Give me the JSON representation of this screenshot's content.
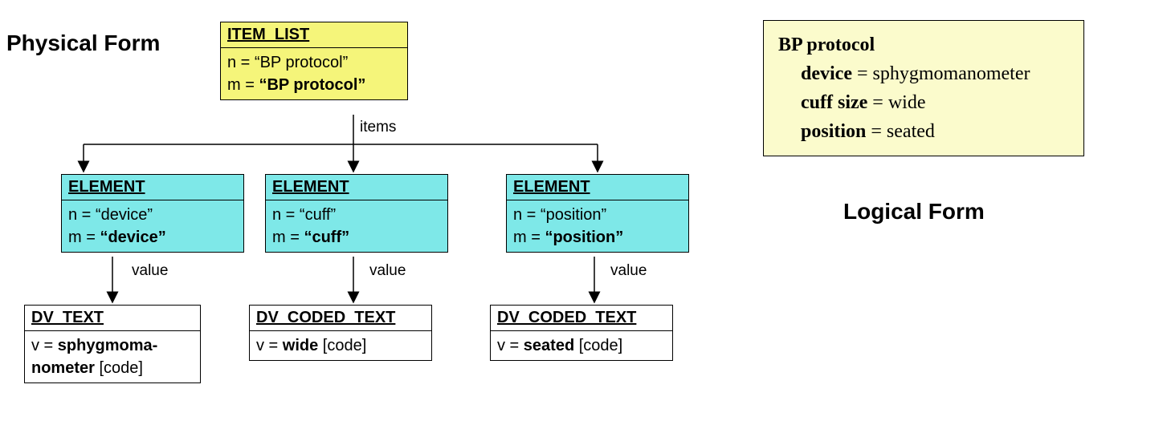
{
  "titles": {
    "physical": "Physical Form",
    "logical": "Logical Form"
  },
  "root": {
    "type": "ITEM_LIST",
    "n": "n = “BP protocol”",
    "m_prefix": "m = ",
    "m_val": "“BP protocol”",
    "edge": "items"
  },
  "elements": [
    {
      "type": "ELEMENT",
      "n": "n = “device”",
      "m_prefix": "m = ",
      "m_val": "“device”",
      "edge": "value",
      "value_type": "DV_TEXT",
      "v_prefix": "v = ",
      "v_bold": "sphygmoma-\nnometer",
      "v_suffix": " [code]"
    },
    {
      "type": "ELEMENT",
      "n": "n = “cuff”",
      "m_prefix": "m = ",
      "m_val": "“cuff”",
      "edge": "value",
      "value_type": "DV_CODED_TEXT",
      "v_prefix": "v = ",
      "v_bold": "wide",
      "v_suffix": " [code]"
    },
    {
      "type": "ELEMENT",
      "n": "n = “position”",
      "m_prefix": "m = ",
      "m_val": "“position”",
      "edge": "value",
      "value_type": "DV_CODED_TEXT",
      "v_prefix": "v = ",
      "v_bold": "seated",
      "v_suffix": " [code]"
    }
  ],
  "logical": {
    "title": "BP protocol",
    "rows": [
      {
        "label": "device",
        "value": "sphygmomanometer"
      },
      {
        "label": "cuff size",
        "value": "wide"
      },
      {
        "label": "position",
        "value": "seated"
      }
    ]
  }
}
